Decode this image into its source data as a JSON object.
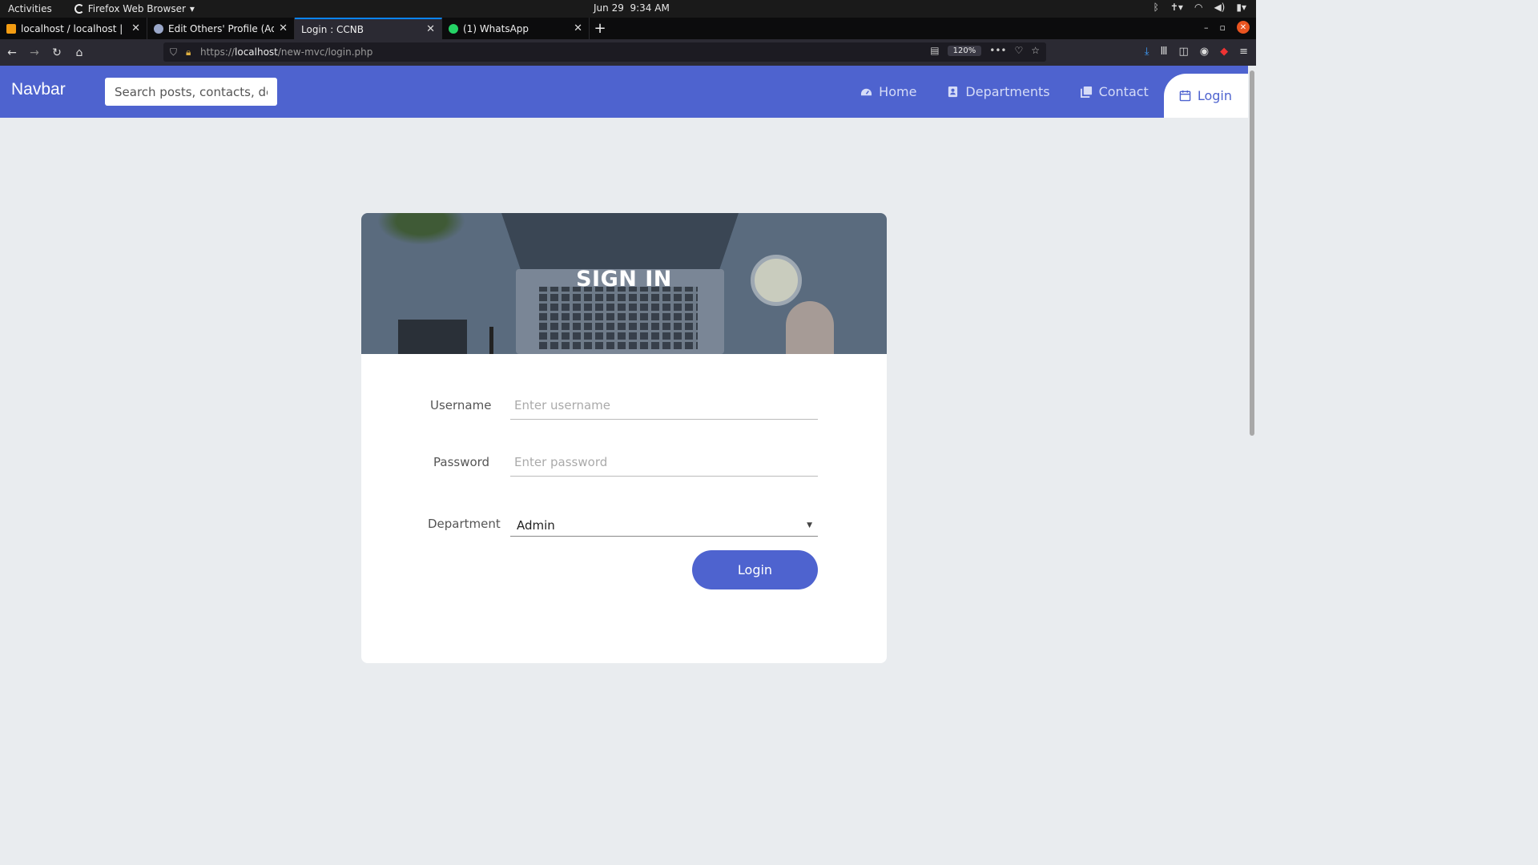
{
  "os": {
    "activities": "Activities",
    "app_menu": "Firefox Web Browser",
    "date": "Jun 29",
    "time": "9:34 AM"
  },
  "browser": {
    "tabs": [
      {
        "title": "localhost / localhost | ph",
        "icon": "phpmyadmin-icon"
      },
      {
        "title": "Edit Others' Profile (Adm",
        "icon": "globe-icon"
      },
      {
        "title": "Login : CCNB",
        "icon": "none",
        "active": true
      },
      {
        "title": "(1) WhatsApp",
        "icon": "whatsapp-icon"
      }
    ],
    "url_scheme": "https://",
    "url_host": "localhost",
    "url_path": "/new-mvc/login.php",
    "zoom": "120%"
  },
  "site": {
    "brand": "Navbar",
    "search_placeholder": "Search posts, contacts, dep",
    "menu": [
      {
        "label": "Home",
        "icon": "dashboard-icon"
      },
      {
        "label": "Departments",
        "icon": "contact-card-icon"
      },
      {
        "label": "Contact",
        "icon": "copy-icon"
      },
      {
        "label": "Login",
        "icon": "calendar-icon",
        "active": true
      }
    ],
    "accent": "#4e63cf"
  },
  "login": {
    "title": "SIGN IN",
    "username_label": "Username",
    "username_placeholder": "Enter username",
    "password_label": "Password",
    "password_placeholder": "Enter password",
    "department_label": "Department",
    "department_value": "Admin",
    "submit": "Login"
  }
}
